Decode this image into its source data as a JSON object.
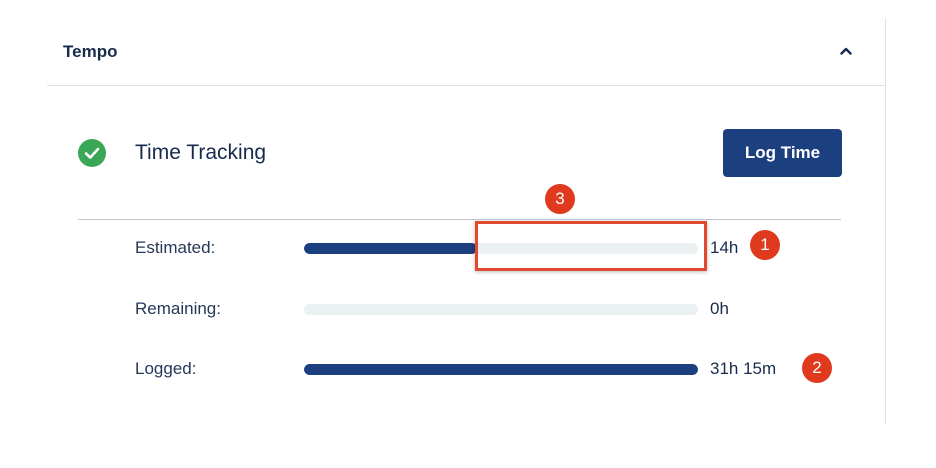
{
  "panel": {
    "title": "Tempo",
    "collapse_icon": "chevron-up-icon"
  },
  "time_tracking": {
    "title": "Time Tracking",
    "status_icon": "check-circle-icon",
    "log_button_label": "Log Time",
    "metrics": [
      {
        "label": "Estimated:",
        "value": "14h",
        "bar_fill_fraction": 0.44
      },
      {
        "label": "Remaining:",
        "value": "0h",
        "bar_fill_fraction": 0.0
      },
      {
        "label": "Logged:",
        "value": "31h 15m",
        "bar_fill_fraction": 1.0
      }
    ]
  },
  "annotations": {
    "callout_1": "1",
    "callout_2": "2",
    "callout_3": "3"
  },
  "colors": {
    "bar_fill": "#1c3f7f",
    "bar_track": "#ebf0f3",
    "button_bg": "#1c3f7f",
    "check_green": "#3aa757",
    "callout_red": "#e03a1e",
    "highlight_red": "#e04b2f"
  }
}
